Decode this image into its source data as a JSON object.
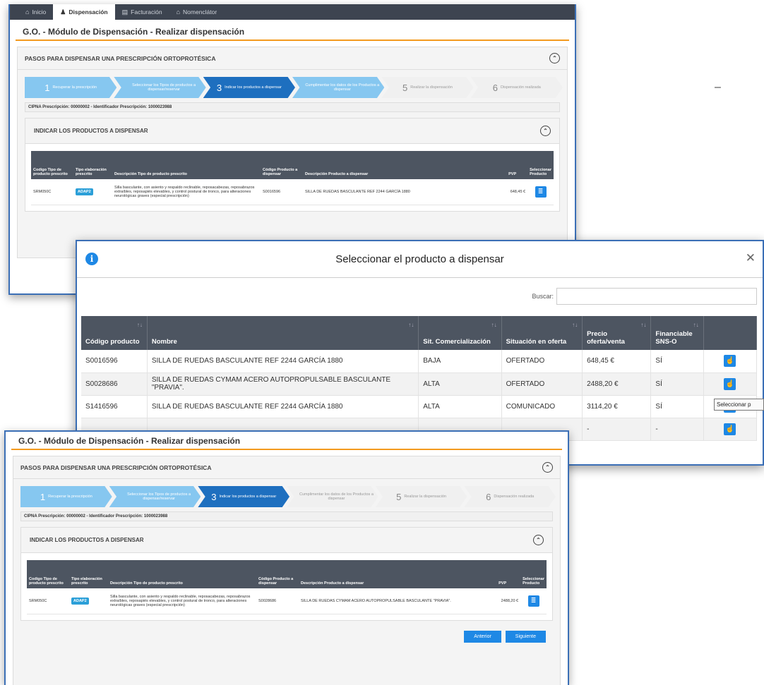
{
  "navbar": {
    "items": [
      {
        "icon": "home-icon",
        "glyph": "⌂",
        "label": "Inicio"
      },
      {
        "icon": "person-icon",
        "glyph": "♟",
        "label": "Dispensación"
      },
      {
        "icon": "document-icon",
        "glyph": "▤",
        "label": "Facturación"
      },
      {
        "icon": "bank-icon",
        "glyph": "⌂",
        "label": "Nomenclátor"
      }
    ]
  },
  "module_title": "G.O. - Módulo de Dispensación - Realizar dispensación",
  "steps_panel_title": "PASOS PARA DISPENSAR UNA PRESCRIPCIÓN ORTOPROTÉSICA",
  "steps": [
    {
      "num": "1",
      "text": "Recuperar la prescripción"
    },
    {
      "num": "2",
      "text": "Seleccionar los Tipos de productos a dispensar/reservar"
    },
    {
      "num": "3",
      "text": "Indicar los productos a dispensar"
    },
    {
      "num": "4",
      "text": "Cumplimentar los datos de los Productos a dispensar"
    },
    {
      "num": "5",
      "text": "Realizar la dispensación"
    },
    {
      "num": "6",
      "text": "Dispensación realizada"
    }
  ],
  "cipna_line": "CIPNA Prescripción: 00000002 - Identificador Prescripción: 1000023988",
  "products_panel_title": "INDICAR LOS PRODUCTOS A DISPENSAR",
  "product_table": {
    "headers": [
      "Codigo Tipo de producto prescrito",
      "Tipo elaboración prescrito",
      "Descripción Tipo de producto prescrito",
      "Código Producto a dispensar",
      "Descripción Producto a dispensar",
      "PVP",
      "Seleccionar Producto"
    ],
    "top_row": {
      "code": "SRM050C",
      "elab": "ADAP2",
      "desc": "Silla basculante, con asiento y respaldo reclinable, reposacabezas, reposabrazos extraíbles, reposapiés elevables, y control postural de tronco, para alteraciones neurológicas graves (especial prescripción)",
      "prod_code": "S0016596",
      "prod_desc": "SILLA DE RUEDAS BASCULANTE REF 2244 GARCÍA 1880",
      "pvp": "648,45 €"
    },
    "bottom_row": {
      "code": "SRM050C",
      "elab": "ADAP2",
      "desc": "Silla basculante, con asiento y respaldo reclinable, reposacabezas, reposabrazos extraíbles, reposapiés elevables, y control postural de tronco, para alteraciones neurológicas graves (especial prescripción)",
      "prod_code": "S0028686",
      "prod_desc": "SILLA DE RUEDAS CYMAM ACERO AUTOPROPULSABLE BASCULANTE \"PRAVIA\".",
      "pvp": "2488,20 €"
    }
  },
  "modal": {
    "title": "Seleccionar el producto a dispensar",
    "search_label": "Buscar:",
    "search_value": "",
    "headers": [
      "Código producto",
      "Nombre",
      "Sit. Comercialización",
      "Situación en oferta",
      "Precio oferta/venta",
      "Financiable SNS-O"
    ],
    "rows": [
      {
        "code": "S0016596",
        "name": "SILLA DE RUEDAS BASCULANTE REF 2244 GARCÍA 1880",
        "sit": "BAJA",
        "oferta": "OFERTADO",
        "precio": "648,45 €",
        "fin": "SÍ"
      },
      {
        "code": "S0028686",
        "name": "SILLA DE RUEDAS CYMAM ACERO AUTOPROPULSABLE BASCULANTE \"PRAVIA\".",
        "sit": "ALTA",
        "oferta": "OFERTADO",
        "precio": "2488,20 €",
        "fin": "SÍ"
      },
      {
        "code": "S1416596",
        "name": "SILLA DE RUEDAS BASCULANTE REF 2244 GARCÍA 1880",
        "sit": "ALTA",
        "oferta": "COMUNICADO",
        "precio": "3114,20 €",
        "fin": "SÍ"
      },
      {
        "code": "",
        "name": "",
        "sit": "",
        "oferta": "",
        "precio": "-",
        "fin": "-"
      }
    ],
    "tooltip": "Seleccionar p"
  },
  "buttons": {
    "anterior": "Anterior",
    "siguiente": "Siguiente"
  },
  "minimize_glyph": "–",
  "colors": {
    "accent": "#1e88e5",
    "orange": "#f39a1e",
    "navbar": "#3d4450",
    "header": "#4d5561"
  }
}
